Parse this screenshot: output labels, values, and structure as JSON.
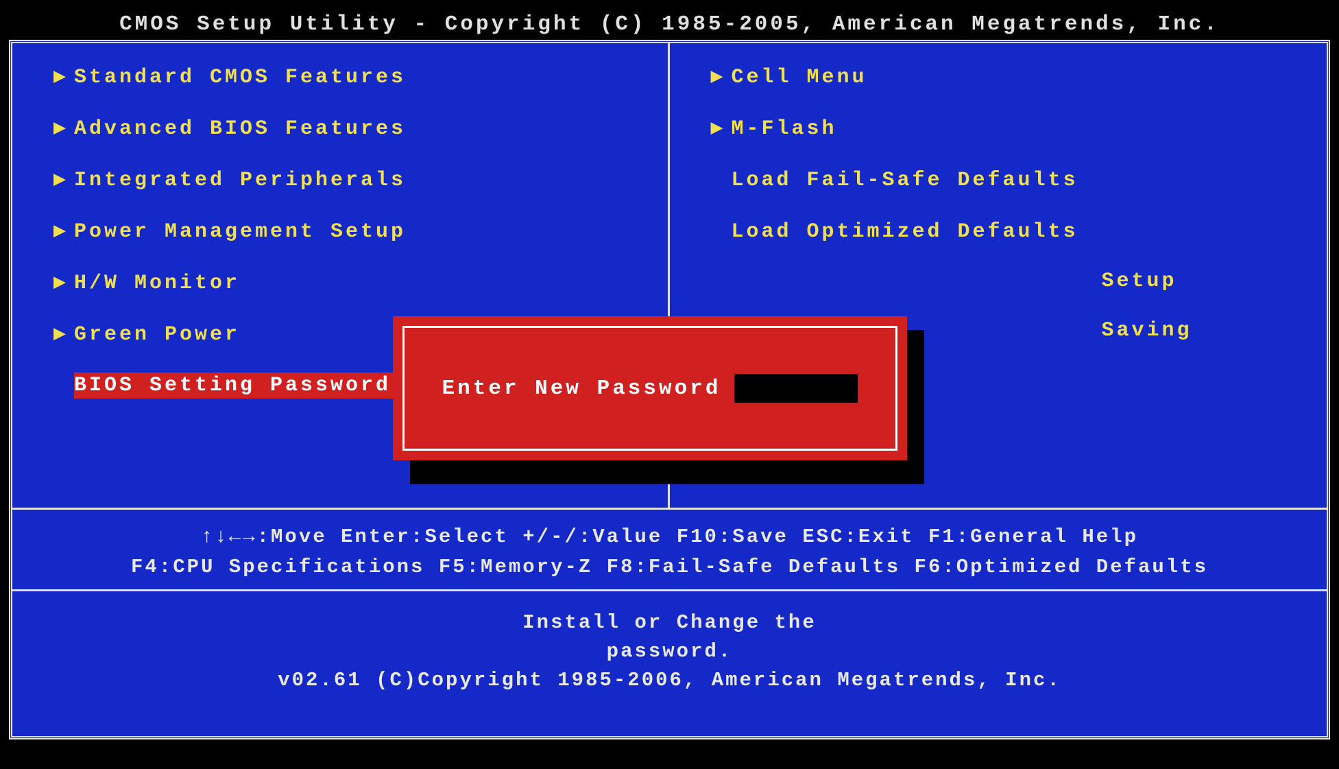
{
  "header": {
    "title": "CMOS Setup Utility - Copyright (C) 1985-2005, American Megatrends, Inc."
  },
  "menu": {
    "left": [
      {
        "label": "Standard CMOS Features",
        "sub": true,
        "selected": false
      },
      {
        "label": "Advanced BIOS Features",
        "sub": true,
        "selected": false
      },
      {
        "label": "Integrated Peripherals",
        "sub": true,
        "selected": false
      },
      {
        "label": "Power Management Setup",
        "sub": true,
        "selected": false
      },
      {
        "label": "H/W Monitor",
        "sub": true,
        "selected": false
      },
      {
        "label": "Green Power",
        "sub": true,
        "selected": false
      },
      {
        "label": "BIOS Setting Password",
        "sub": false,
        "selected": true
      }
    ],
    "right": [
      {
        "label": "Cell Menu",
        "sub": true,
        "selected": false
      },
      {
        "label": "M-Flash",
        "sub": true,
        "selected": false
      },
      {
        "label": "Load Fail-Safe Defaults",
        "sub": false,
        "selected": false
      },
      {
        "label": "Load Optimized Defaults",
        "sub": false,
        "selected": false
      },
      {
        "label": "Setup",
        "sub": false,
        "selected": false,
        "obscured": true
      },
      {
        "label": "Saving",
        "sub": false,
        "selected": false,
        "obscured": true
      }
    ]
  },
  "help": {
    "line1": "↑↓←→:Move   Enter:Select   +/-/:Value   F10:Save   ESC:Exit   F1:General Help",
    "line2": "F4:CPU Specifications F5:Memory-Z F8:Fail-Safe Defaults F6:Optimized Defaults"
  },
  "status": {
    "line1": "Install or Change the",
    "line2": "password.",
    "line3": "v02.61 (C)Copyright 1985-2006, American Megatrends, Inc."
  },
  "dialog": {
    "label": "Enter New Password",
    "value": ""
  }
}
